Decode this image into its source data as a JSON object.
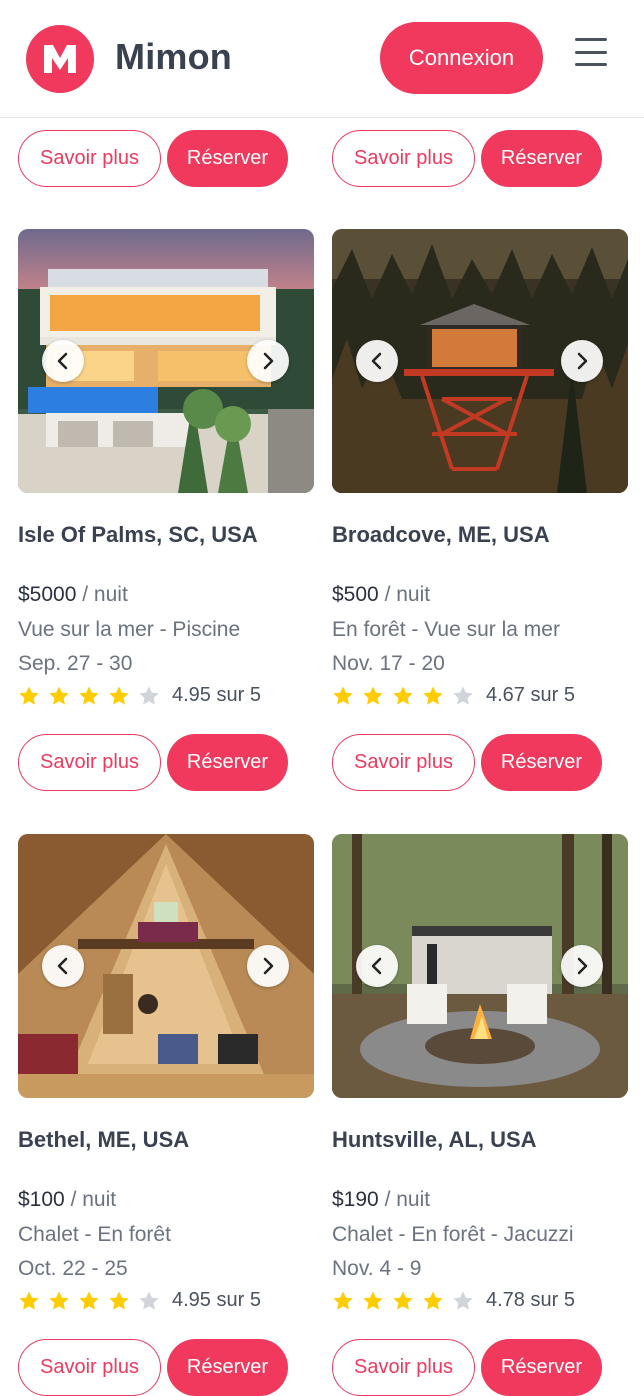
{
  "header": {
    "logo_letter": "M",
    "brand": "Mimon",
    "login_label": "Connexion"
  },
  "colors": {
    "accent": "#f0395d",
    "star": "#ffcc00",
    "star_empty": "#d1d5db"
  },
  "buttons": {
    "more_label": "Savoir plus",
    "book_label": "Réserver"
  },
  "per_night": "/ nuit",
  "listings": [
    {
      "title": "Isle Of Palms, SC, USA",
      "price": "$5000",
      "tags": "Vue sur la mer - Piscine",
      "dates": "Sep. 27 - 30",
      "rating_text": "4.95 sur 5",
      "rating_value": 4.95
    },
    {
      "title": "Broadcove, ME, USA",
      "price": "$500",
      "tags": "En forêt - Vue sur la mer",
      "dates": "Nov. 17 - 20",
      "rating_text": "4.67 sur 5",
      "rating_value": 4.67
    },
    {
      "title": "Bethel, ME, USA",
      "price": "$100",
      "tags": "Chalet - En forêt",
      "dates": "Oct. 22 - 25",
      "rating_text": "4.95 sur 5",
      "rating_value": 4.95
    },
    {
      "title": "Huntsville, AL, USA",
      "price": "$190",
      "tags": "Chalet - En forêt - Jacuzzi",
      "dates": "Nov. 4 - 9",
      "rating_text": "4.78 sur 5",
      "rating_value": 4.78
    }
  ],
  "icons": {
    "prev": "chevron-left-icon",
    "next": "chevron-right-icon",
    "menu": "hamburger-menu-icon",
    "star": "star-icon"
  }
}
